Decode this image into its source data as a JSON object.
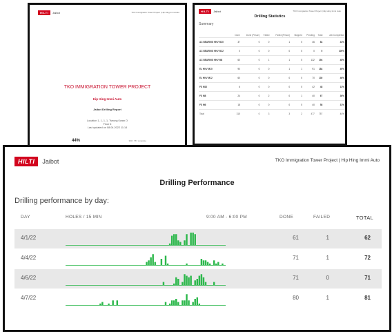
{
  "cover": {
    "logo": "HILTI",
    "app": "Jaibot",
    "header_right": "TKO Immigration Tower Project | Hip Hing Immi Auto",
    "title": "TKO IMMIGRATION TOWER PROJECT",
    "subtitle": "Hip Hing Immi Auto",
    "report": "Jaibot Drilling Report",
    "location_lines": [
      "Location 1, 1, 1, 1, Tseung Kwan O",
      "Floor 6",
      "Last updated on 08.04.2022 11:14"
    ],
    "progress_label": "44%",
    "progress": 0.44,
    "progress_count": "390 / 757 complete"
  },
  "stats": {
    "logo": "HILTI",
    "app": "Jaibot",
    "header_right": "TKO Immigration Tower Project | Hip Hing Immi Auto",
    "title": "Drilling Statistics",
    "summary_label": "Summary",
    "columns": [
      "",
      "Done",
      "Done (Prison)",
      "Failed",
      "Failed (Prison)",
      "Skipped",
      "Pending",
      "Total",
      "Job Completion"
    ],
    "rows": [
      [
        "AC BEARING HKV M10",
        "37",
        "0",
        "0",
        "1",
        "0",
        "46",
        "84",
        "44%"
      ],
      [
        "AC BEARING HKV M12",
        "0",
        "0",
        "0",
        "0",
        "0",
        "0",
        "0",
        "100%"
      ],
      [
        "AC BEARING HKV M8",
        "60",
        "0",
        "1",
        "1",
        "0",
        "132",
        "194",
        "45%"
      ],
      [
        "EL HKV M10",
        "90",
        "0",
        "0",
        "1",
        "1",
        "91",
        "184",
        "49%"
      ],
      [
        "EL HKV M12",
        "60",
        "0",
        "0",
        "0",
        "0",
        "70",
        "130",
        "46%"
      ],
      [
        "FS M10",
        "6",
        "0",
        "0",
        "0",
        "0",
        "42",
        "48",
        "13%"
      ],
      [
        "FS M8",
        "24",
        "0",
        "2",
        "0",
        "1",
        "40",
        "67",
        "36%"
      ],
      [
        "FS M6",
        "18",
        "0",
        "0",
        "0",
        "0",
        "40",
        "58",
        "31%"
      ],
      [
        "Total",
        "315",
        "0",
        "3",
        "3",
        "2",
        "477",
        "757",
        "44%"
      ]
    ]
  },
  "main": {
    "logo": "HILTI",
    "app": "Jaibot",
    "header_right": "TKO Immigration Tower Project | Hip Hing Immi Auto",
    "title": "Drilling Performance",
    "section": "Drilling performance by day:",
    "col_day": "DAY",
    "col_holes": "HOLES / 15 MIN",
    "col_time": "9:00 AM - 6:00 PM",
    "col_done": "DONE",
    "col_failed": "FAILED",
    "col_total": "TOTAL",
    "bar_color": "#2db84c",
    "rows": [
      {
        "date": "4/1/22",
        "done": "61",
        "failed": "1",
        "total": "62",
        "holes": [
          0,
          0,
          0,
          0,
          0,
          0,
          0,
          0,
          0,
          0,
          0,
          0,
          0,
          0,
          0,
          0,
          0,
          0,
          0,
          0,
          0,
          0,
          0,
          0,
          0,
          0,
          0,
          0,
          0,
          0,
          0,
          0,
          0,
          0,
          0,
          0,
          0,
          0,
          0,
          0,
          0,
          0,
          0,
          0,
          0,
          0,
          0,
          0,
          0,
          1,
          6,
          7,
          7,
          3,
          2,
          0,
          3,
          7,
          0,
          8,
          8,
          7,
          0,
          0,
          0,
          0,
          0,
          0,
          0,
          0,
          0,
          0,
          0,
          0,
          0,
          0
        ]
      },
      {
        "date": "4/4/22",
        "done": "71",
        "failed": "1",
        "total": "72",
        "holes": [
          0,
          0,
          0,
          0,
          0,
          0,
          0,
          0,
          0,
          0,
          0,
          0,
          0,
          0,
          0,
          0,
          0,
          0,
          0,
          0,
          0,
          0,
          0,
          0,
          0,
          0,
          0,
          0,
          0,
          0,
          0,
          0,
          0,
          0,
          0,
          0,
          0,
          0,
          2,
          3,
          5,
          7,
          2,
          0,
          0,
          4,
          0,
          6,
          1,
          0,
          0,
          0,
          0,
          0,
          0,
          0,
          0,
          1,
          0,
          0,
          0,
          0,
          0,
          0,
          4,
          3,
          3,
          2,
          1,
          0,
          3,
          1,
          2,
          0,
          1,
          0
        ]
      },
      {
        "date": "4/6/22",
        "done": "71",
        "failed": "0",
        "total": "71",
        "holes": [
          0,
          0,
          0,
          0,
          0,
          0,
          0,
          0,
          0,
          0,
          0,
          0,
          0,
          0,
          0,
          0,
          0,
          0,
          0,
          0,
          0,
          0,
          0,
          0,
          0,
          0,
          0,
          0,
          0,
          0,
          0,
          0,
          0,
          0,
          0,
          0,
          0,
          0,
          0,
          0,
          0,
          0,
          0,
          0,
          0,
          0,
          2,
          0,
          0,
          0,
          0,
          1,
          5,
          4,
          0,
          2,
          7,
          6,
          5,
          6,
          0,
          3,
          4,
          6,
          7,
          5,
          2,
          0,
          0,
          0,
          2,
          0,
          0,
          0,
          0,
          0
        ]
      },
      {
        "date": "4/7/22",
        "done": "80",
        "failed": "1",
        "total": "81",
        "holes": [
          0,
          0,
          0,
          0,
          0,
          0,
          0,
          0,
          0,
          0,
          0,
          0,
          0,
          0,
          0,
          0,
          1,
          2,
          0,
          0,
          1,
          0,
          3,
          0,
          3,
          0,
          0,
          0,
          0,
          0,
          0,
          0,
          0,
          0,
          0,
          0,
          0,
          0,
          0,
          0,
          0,
          0,
          0,
          0,
          0,
          0,
          0,
          2,
          0,
          1,
          3,
          3,
          4,
          2,
          0,
          3,
          3,
          7,
          3,
          0,
          2,
          4,
          5,
          1,
          0,
          0,
          0,
          0,
          0,
          0,
          0,
          0,
          0,
          0,
          0,
          0
        ]
      }
    ]
  }
}
